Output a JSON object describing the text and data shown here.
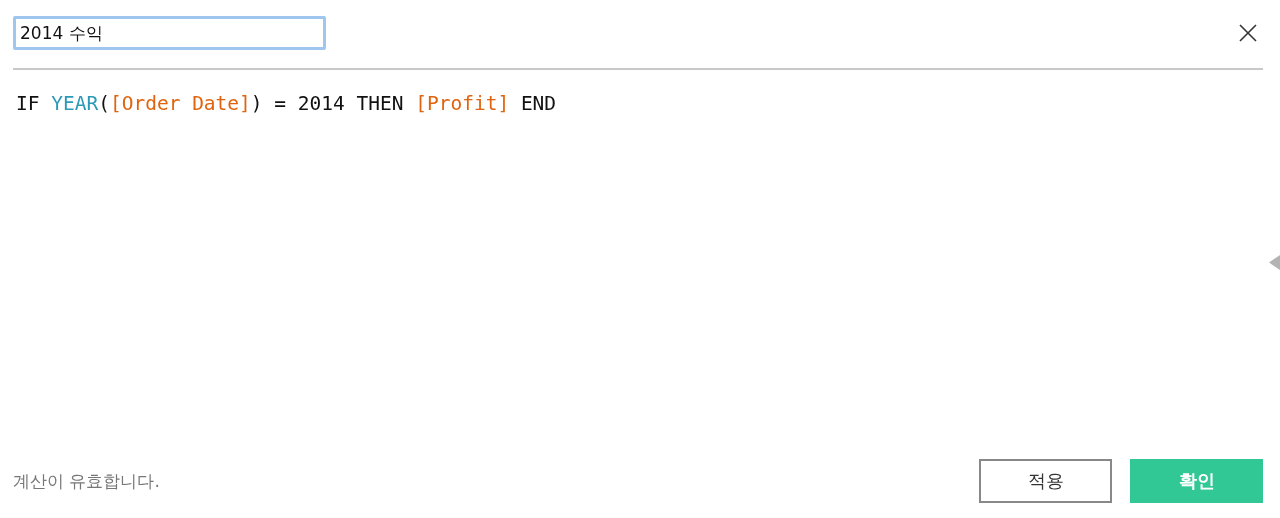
{
  "name_field": {
    "value": "2014 수익"
  },
  "formula": [
    {
      "kind": "plain",
      "text": "IF "
    },
    {
      "kind": "function",
      "text": "YEAR"
    },
    {
      "kind": "plain",
      "text": "("
    },
    {
      "kind": "field",
      "text": "[Order Date]"
    },
    {
      "kind": "plain",
      "text": ") = 2014 THEN "
    },
    {
      "kind": "field",
      "text": "[Profit]"
    },
    {
      "kind": "plain",
      "text": " END"
    }
  ],
  "status": "계산이 유효합니다.",
  "buttons": [
    {
      "label": "적용",
      "kind": "secondary"
    },
    {
      "label": "확인",
      "kind": "primary"
    }
  ]
}
